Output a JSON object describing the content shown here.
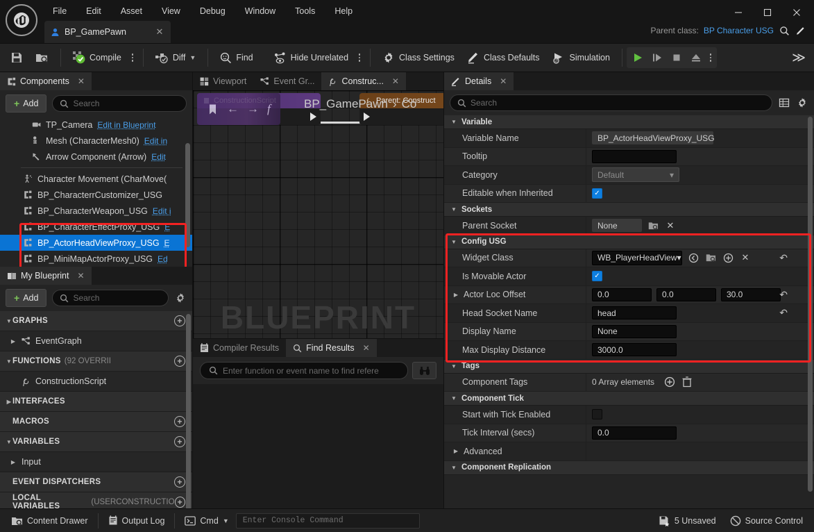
{
  "window": {
    "menus": [
      "File",
      "Edit",
      "Asset",
      "View",
      "Debug",
      "Window",
      "Tools",
      "Help"
    ],
    "document_tab": "BP_GamePawn",
    "parent_class_label": "Parent class:",
    "parent_class_value": "BP Character USG",
    "minimize": "–",
    "maximize": "☐",
    "close": "✕",
    "tab_close": "✕"
  },
  "toolbar": {
    "save": "save-icon",
    "browse": "browse-icon",
    "compile": "Compile",
    "diff": "Diff",
    "find": "Find",
    "hide_unrelated": "Hide Unrelated",
    "class_settings": "Class Settings",
    "class_defaults": "Class Defaults",
    "simulation": "Simulation",
    "overflow": "≫"
  },
  "components": {
    "tab_label": "Components",
    "add_label": "Add",
    "search_placeholder": "Search",
    "items": [
      {
        "name": "TP_Camera",
        "link": "Edit in Blueprint",
        "indent": 2,
        "icon": "camera-icon",
        "selected": false,
        "clipped": true
      },
      {
        "name": "Mesh (CharacterMesh0)",
        "link": "Edit in",
        "indent": 2,
        "icon": "skeleton-icon",
        "selected": false,
        "clipped": false
      },
      {
        "name": "Arrow Component (Arrow)",
        "link": "Edit",
        "indent": 2,
        "icon": "arrow-icon",
        "selected": false,
        "clipped": false
      },
      {
        "name": "Character Movement (CharMove(",
        "link": "",
        "indent": 1,
        "icon": "movement-icon",
        "selected": false,
        "clipped": false
      },
      {
        "name": "BP_CharacterrCustomizer_USG",
        "link": "",
        "indent": 1,
        "icon": "cube-icon",
        "selected": false,
        "clipped": false
      },
      {
        "name": "BP_CharacterWeapon_USG",
        "link": "Edit i",
        "indent": 1,
        "icon": "cube-icon",
        "selected": false,
        "clipped": false
      },
      {
        "name": "BP_CharacterEffectProxy_USG",
        "link": "E",
        "indent": 1,
        "icon": "cube-icon",
        "selected": false,
        "clipped": true
      },
      {
        "name": "BP_ActorHeadViewProxy_USG",
        "link": "E",
        "indent": 1,
        "icon": "cube-icon",
        "selected": true,
        "clipped": false
      },
      {
        "name": "BP_MiniMapActorProxy_USG",
        "link": "Ed",
        "indent": 1,
        "icon": "cube-icon",
        "selected": false,
        "clipped": false
      }
    ]
  },
  "my_blueprint": {
    "tab_label": "My Blueprint",
    "add_label": "Add",
    "search_placeholder": "Search",
    "rows": [
      {
        "kind": "category",
        "label": "GRAPHS",
        "sub": "",
        "expanded": true,
        "add": true
      },
      {
        "kind": "item",
        "label": "EventGraph",
        "icon": "graph-icon",
        "tri": "right"
      },
      {
        "kind": "category",
        "label": "FUNCTIONS",
        "sub": "(92 OVERRII",
        "expanded": true,
        "add": true
      },
      {
        "kind": "item",
        "label": "ConstructionScript",
        "icon": "function-icon",
        "tri": "none"
      },
      {
        "kind": "category",
        "label": "INTERFACES",
        "sub": "",
        "expanded": false,
        "add": false
      },
      {
        "kind": "category",
        "label": "MACROS",
        "sub": "",
        "expanded": "none",
        "add": true
      },
      {
        "kind": "category",
        "label": "VARIABLES",
        "sub": "",
        "expanded": true,
        "add": true
      },
      {
        "kind": "item",
        "label": "Input",
        "icon": "none",
        "tri": "right"
      },
      {
        "kind": "category",
        "label": "EVENT DISPATCHERS",
        "sub": "",
        "expanded": "none",
        "add": true
      },
      {
        "kind": "category",
        "label": "LOCAL VARIABLES",
        "sub": "(USERCONSTRUCTIO",
        "expanded": "none",
        "add": true
      }
    ]
  },
  "center": {
    "tabs": [
      {
        "label": "Viewport",
        "icon": "viewport-icon",
        "active": false,
        "closable": false
      },
      {
        "label": "Event Gr...",
        "icon": "graph-icon",
        "active": false,
        "closable": false
      },
      {
        "label": "Construc...",
        "icon": "function-icon",
        "active": true,
        "closable": true
      }
    ],
    "graph_overlay_title": "ConstructionScript",
    "breadcrumb": "BP_GamePawn",
    "breadcrumb_sep": "›",
    "breadcrumb_2": "Co",
    "watermark": "BLUEPRINT",
    "node1_title": "ConstructionScript",
    "node2_title": "Parent: Construct",
    "bottom_tabs": [
      {
        "label": "Compiler Results",
        "icon": "compiler-icon",
        "active": false,
        "closable": false
      },
      {
        "label": "Find Results",
        "icon": "search-icon",
        "active": true,
        "closable": true
      }
    ],
    "find_placeholder": "Enter function or event name to find refere"
  },
  "details": {
    "tab_label": "Details",
    "search_placeholder": "Search",
    "sections": [
      {
        "name": "Variable",
        "expanded": true,
        "highlight": false,
        "rows": [
          {
            "label": "Variable Name",
            "type": "text-flat",
            "value": "BP_ActorHeadViewProxy_USG",
            "reset": false
          },
          {
            "label": "Tooltip",
            "type": "text-dark",
            "value": "",
            "reset": false
          },
          {
            "label": "Category",
            "type": "combo",
            "value": "Default",
            "reset": false
          },
          {
            "label": "Editable when Inherited",
            "type": "checkbox",
            "value": true,
            "reset": false
          }
        ]
      },
      {
        "name": "Sockets",
        "expanded": true,
        "highlight": false,
        "rows": [
          {
            "label": "Parent Socket",
            "type": "socket",
            "value": "None",
            "reset": false
          }
        ]
      },
      {
        "name": "Config USG",
        "expanded": true,
        "highlight": true,
        "rows": [
          {
            "label": "Widget Class",
            "type": "asset-combo",
            "value": "WB_PlayerHeadView",
            "reset": true
          },
          {
            "label": "Is Movable Actor",
            "type": "checkbox",
            "value": true,
            "reset": false
          },
          {
            "label": "Actor Loc Offset",
            "type": "vector3",
            "value": [
              "0.0",
              "0.0",
              "30.0"
            ],
            "reset": true,
            "expandable": true
          },
          {
            "label": "Head Socket Name",
            "type": "text-dark",
            "value": "head",
            "reset": true
          },
          {
            "label": "Display Name",
            "type": "text-dark",
            "value": "None",
            "reset": false
          },
          {
            "label": "Max Display Distance",
            "type": "text-dark",
            "value": "3000.0",
            "reset": false
          }
        ]
      },
      {
        "name": "Tags",
        "expanded": true,
        "highlight": false,
        "rows": [
          {
            "label": "Component Tags",
            "type": "array",
            "value": "0 Array elements",
            "reset": false
          }
        ]
      },
      {
        "name": "Component Tick",
        "expanded": true,
        "highlight": false,
        "rows": [
          {
            "label": "Start with Tick Enabled",
            "type": "checkbox-off",
            "value": false,
            "reset": false
          },
          {
            "label": "Tick Interval (secs)",
            "type": "text-dark",
            "value": "0.0",
            "reset": false
          },
          {
            "label": "Advanced",
            "type": "subgroup",
            "value": "",
            "reset": false
          }
        ]
      },
      {
        "name": "Component Replication",
        "expanded": true,
        "highlight": false,
        "rows": []
      }
    ]
  },
  "statusbar": {
    "content_drawer": "Content Drawer",
    "output_log": "Output Log",
    "cmd": "Cmd",
    "console_placeholder": "Enter Console Command",
    "unsaved": "5 Unsaved",
    "source_control": "Source Control"
  },
  "colors": {
    "accent_blue": "#0a74d4",
    "link_blue": "#4a9ee8",
    "highlight_red": "#f32222",
    "compile_green": "#7ec45a",
    "play_green": "#61c040"
  }
}
